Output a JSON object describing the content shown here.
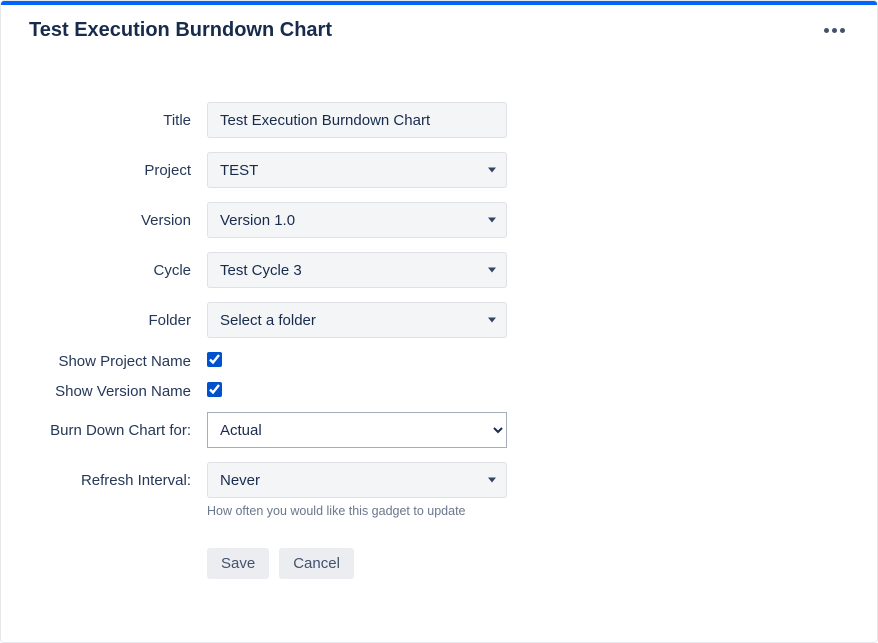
{
  "header": {
    "title": "Test Execution Burndown Chart"
  },
  "labels": {
    "title": "Title",
    "project": "Project",
    "version": "Version",
    "cycle": "Cycle",
    "folder": "Folder",
    "showProjectName": "Show Project Name",
    "showVersionName": "Show Version Name",
    "burnDownFor": "Burn Down Chart for:",
    "refreshInterval": "Refresh Interval:"
  },
  "values": {
    "title": "Test Execution Burndown Chart",
    "project": "TEST",
    "version": "Version 1.0",
    "cycle": "Test Cycle 3",
    "folder": "Select a folder",
    "showProjectName": true,
    "showVersionName": true,
    "burnDownFor": "Actual",
    "refreshInterval": "Never"
  },
  "help": {
    "refresh": "How often you would like this gadget to update"
  },
  "buttons": {
    "save": "Save",
    "cancel": "Cancel"
  }
}
